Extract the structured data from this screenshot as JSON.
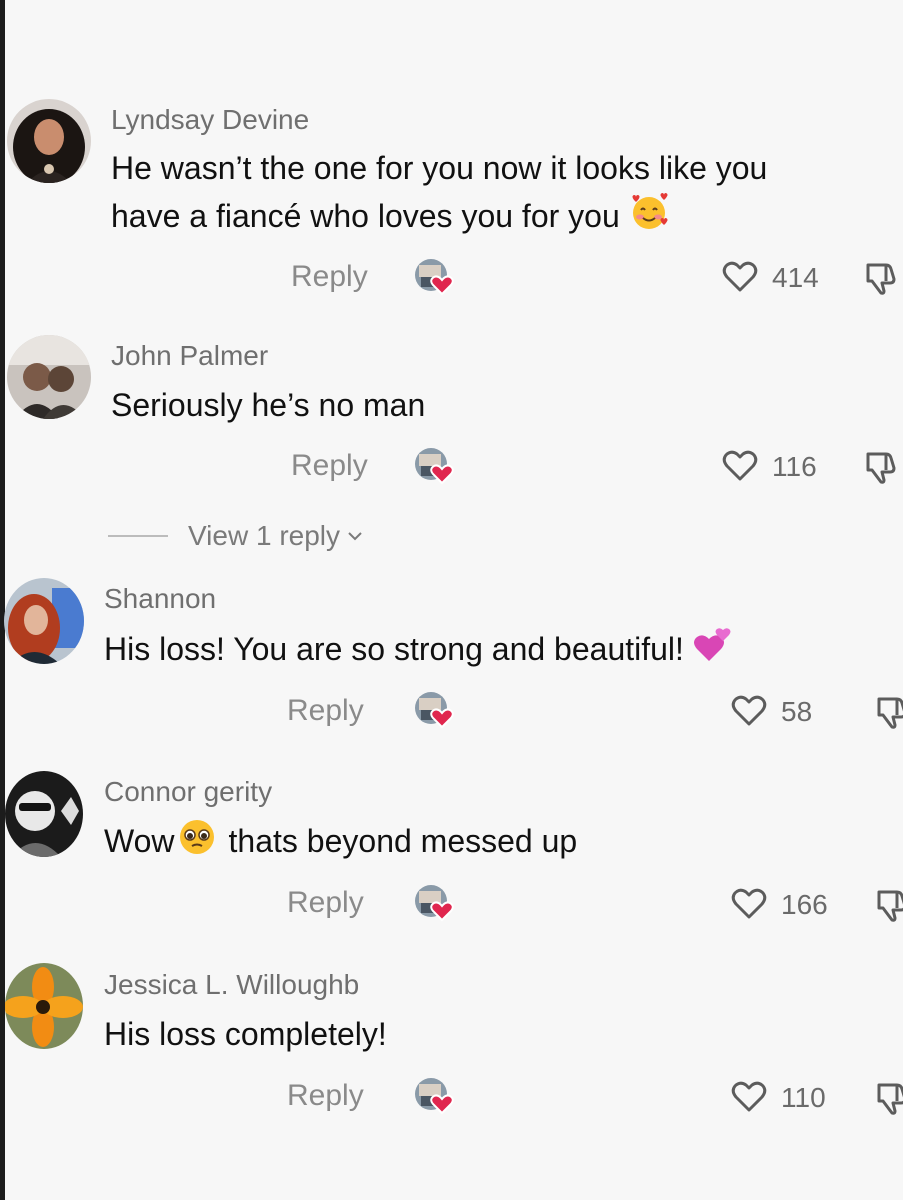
{
  "comments": [
    {
      "username": "Lyndsay Devine",
      "lines": [
        "He wasn’t the one for you now it looks like you",
        "have a fiancé who loves you for you"
      ],
      "reply_label": "Reply",
      "likes": "414",
      "emoji": "smiling-face-with-hearts",
      "avatar": "woman-dark-curly-hair"
    },
    {
      "username": "John Palmer",
      "lines": [
        "Seriously he’s no man"
      ],
      "reply_label": "Reply",
      "likes": "116",
      "avatar": "man-photo"
    },
    {
      "username": "Shannon",
      "lines": [
        "His loss! You are so strong and beautiful!"
      ],
      "reply_label": "Reply",
      "likes": "58",
      "emoji": "two-hearts",
      "avatar": "woman-red-hair"
    },
    {
      "username": "Connor gerity",
      "lines_parts": [
        "Wow",
        "thats beyond messed up"
      ],
      "reply_label": "Reply",
      "likes": "166",
      "emoji": "pleading-face",
      "avatar": "man-sunglasses"
    },
    {
      "username": "Jessica L. Willoughb",
      "lines": [
        "His loss completely!"
      ],
      "reply_label": "Reply",
      "likes": "110",
      "avatar": "orange-flower"
    }
  ],
  "view_replies": "View 1 reply",
  "colors": {
    "background": "#f7f7f7",
    "text": "#111111",
    "muted": "#8a8a8a",
    "heart_badge": "#e0264e"
  },
  "icons": [
    "heart-outline-icon",
    "dislike-icon",
    "creator-liked-badge-icon",
    "chevron-down-icon"
  ]
}
